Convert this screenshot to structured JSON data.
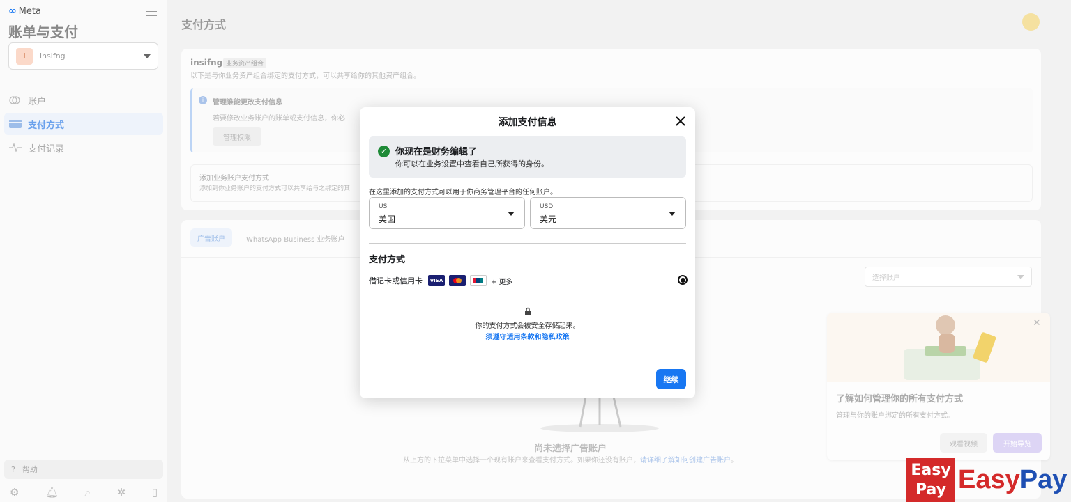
{
  "sidebar": {
    "logo": "Meta",
    "title": "账单与支付",
    "account": {
      "initial": "I",
      "name": "insifng"
    },
    "nav": [
      {
        "label": "账户",
        "icon": "coins-icon"
      },
      {
        "label": "支付方式",
        "icon": "credit-card-icon"
      },
      {
        "label": "支付记录",
        "icon": "activity-icon"
      }
    ],
    "help": "帮助"
  },
  "main": {
    "page_title": "支付方式",
    "portfolio": {
      "name": "insifng",
      "tag": "业务资产组合",
      "desc": "以下是与你业务资产组合绑定的支付方式，可以共享给你的其他资产组合。"
    },
    "notice": {
      "title": "管理谁能更改支付信息",
      "text": "若要修改业务账户的账单或支付信息，你必",
      "button": "管理权限"
    },
    "add_section": {
      "title": "添加业务账户支付方式",
      "text": "添加到你业务账户的支付方式可以共享给与之绑定的其"
    },
    "tabs": [
      "广告账户",
      "WhatsApp Business 业务账户"
    ],
    "select_placeholder": "选择账户",
    "empty": {
      "title": "尚未选择广告账户",
      "text": "从上方的下拉菜单中选择一个现有账户来查看支付方式。如果你还没有账户，",
      "link": "请详细了解如何创建广告账户",
      "end": "。"
    }
  },
  "promo": {
    "title": "了解如何管理你的所有支付方式",
    "text": "管理与你的账户绑定的所有支付方式。",
    "watch": "观看视频",
    "start": "开始导览"
  },
  "modal": {
    "title": "添加支付信息",
    "success_title": "你现在是财务编辑了",
    "success_text": "你可以在业务设置中查看自己所获得的身份。",
    "desc": "在这里添加的支付方式可以用于你商务管理平台的任何账户。",
    "country": {
      "code": "US",
      "label": "美国"
    },
    "currency": {
      "code": "USD",
      "label": "美元"
    },
    "section_title": "支付方式",
    "card_option": "借记卡或信用卡",
    "card_logos": [
      "VISA",
      "MC",
      "UP"
    ],
    "more": "+ 更多",
    "secure_text": "你的支付方式会被安全存储起来。",
    "terms_link": "须遵守适用条款和隐私政策",
    "continue": "继续"
  },
  "watermark": {
    "box_line1": "Easy",
    "box_line2": "Pay",
    "text_a": "Easy",
    "text_b": "Pay"
  },
  "colors": {
    "primary": "#1877f2",
    "success": "#1e8a37",
    "brand_red": "#d42a2a"
  }
}
